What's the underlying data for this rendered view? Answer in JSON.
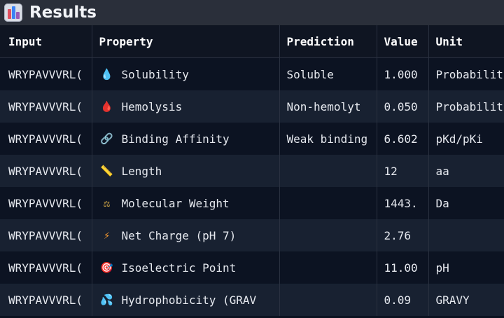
{
  "window": {
    "title": "Results"
  },
  "columns": [
    "Input",
    "Property",
    "Prediction",
    "Value",
    "Unit"
  ],
  "rows": [
    {
      "input": "WRYPAVVVRL(",
      "icon": "droplet-icon",
      "glyph": "💧",
      "property": "Solubility",
      "prediction": "Soluble",
      "value": "1.000",
      "unit": "Probabilit"
    },
    {
      "input": "WRYPAVVVRL(",
      "icon": "blood-drop-icon",
      "glyph": "🩸",
      "property": "Hemolysis",
      "prediction": "Non-hemolyt",
      "value": "0.050",
      "unit": "Probabilit"
    },
    {
      "input": "WRYPAVVVRL(",
      "icon": "link-icon",
      "glyph": "🔗",
      "property": "Binding Affinity",
      "prediction": "Weak binding",
      "value": "6.602",
      "unit": "pKd/pKi"
    },
    {
      "input": "WRYPAVVVRL(",
      "icon": "ruler-icon",
      "glyph": "📏",
      "property": "Length",
      "prediction": "",
      "value": "12",
      "unit": "aa"
    },
    {
      "input": "WRYPAVVVRL(",
      "icon": "scale-icon",
      "glyph": "⚖",
      "property": "Molecular Weight",
      "prediction": "",
      "value": "1443.",
      "unit": "Da"
    },
    {
      "input": "WRYPAVVVRL(",
      "icon": "lightning-icon",
      "glyph": "⚡",
      "property": "Net Charge (pH 7)",
      "prediction": "",
      "value": "2.76",
      "unit": ""
    },
    {
      "input": "WRYPAVVVRL(",
      "icon": "target-icon",
      "glyph": "🎯",
      "property": "Isoelectric Point",
      "prediction": "",
      "value": "11.00",
      "unit": "pH"
    },
    {
      "input": "WRYPAVVVRL(",
      "icon": "water-splash-icon",
      "glyph": "💦",
      "property": "Hydrophobicity (GRAV",
      "prediction": "",
      "value": "0.09",
      "unit": "GRAVY"
    }
  ]
}
